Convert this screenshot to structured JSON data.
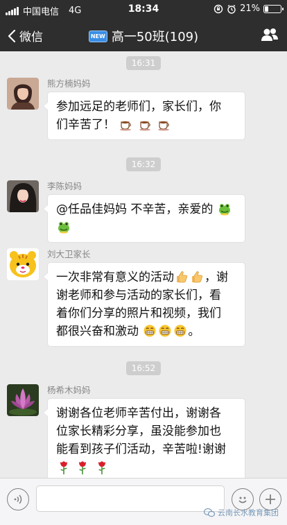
{
  "status_bar": {
    "carrier": "中国电信",
    "network": "4G",
    "time": "18:34",
    "battery": "21%",
    "battery_level": 0.21
  },
  "nav": {
    "back_label": "微信",
    "group_badge": "NEW",
    "title": "高一50班(109)"
  },
  "messages": [
    {
      "timestamp": "16:31",
      "sender": "熊方楠妈妈",
      "line1": "参加远足的老师们，家长们，你",
      "line2": "们辛苦了！",
      "emoji": "coffee-icon"
    },
    {
      "timestamp": "16:32",
      "sender": "李陈妈妈",
      "line1": "@任品佳妈妈 不辛苦，亲爱的",
      "emoji": "frog-icon"
    },
    {
      "sender": "刘大卫家长",
      "line1": "一次非常有意义的活动",
      "line2": "，谢",
      "line3": "谢老师和参与活动的家长们，看",
      "line4": "着你们分享的照片和视频，我们",
      "line5": "都很兴奋和激动",
      "line5_end": "。",
      "emoji": "thumbs-up-icon"
    },
    {
      "timestamp": "16:52",
      "sender": "杨希木妈妈",
      "line1": "谢谢各位老师辛苦付出，谢谢各",
      "line2": "位家长精彩分享，虽没能参加也",
      "line3": "能看到孩子们活动，辛苦啦!谢谢",
      "emoji": "rose-icon"
    }
  ],
  "input_bar": {
    "watermark": "云南长水教育集团"
  },
  "colors": {
    "nav_bg": "#2e2e2e",
    "chat_bg": "#ebebeb",
    "bubble_bg": "#ffffff",
    "timestamp_bg": "#cecece"
  }
}
